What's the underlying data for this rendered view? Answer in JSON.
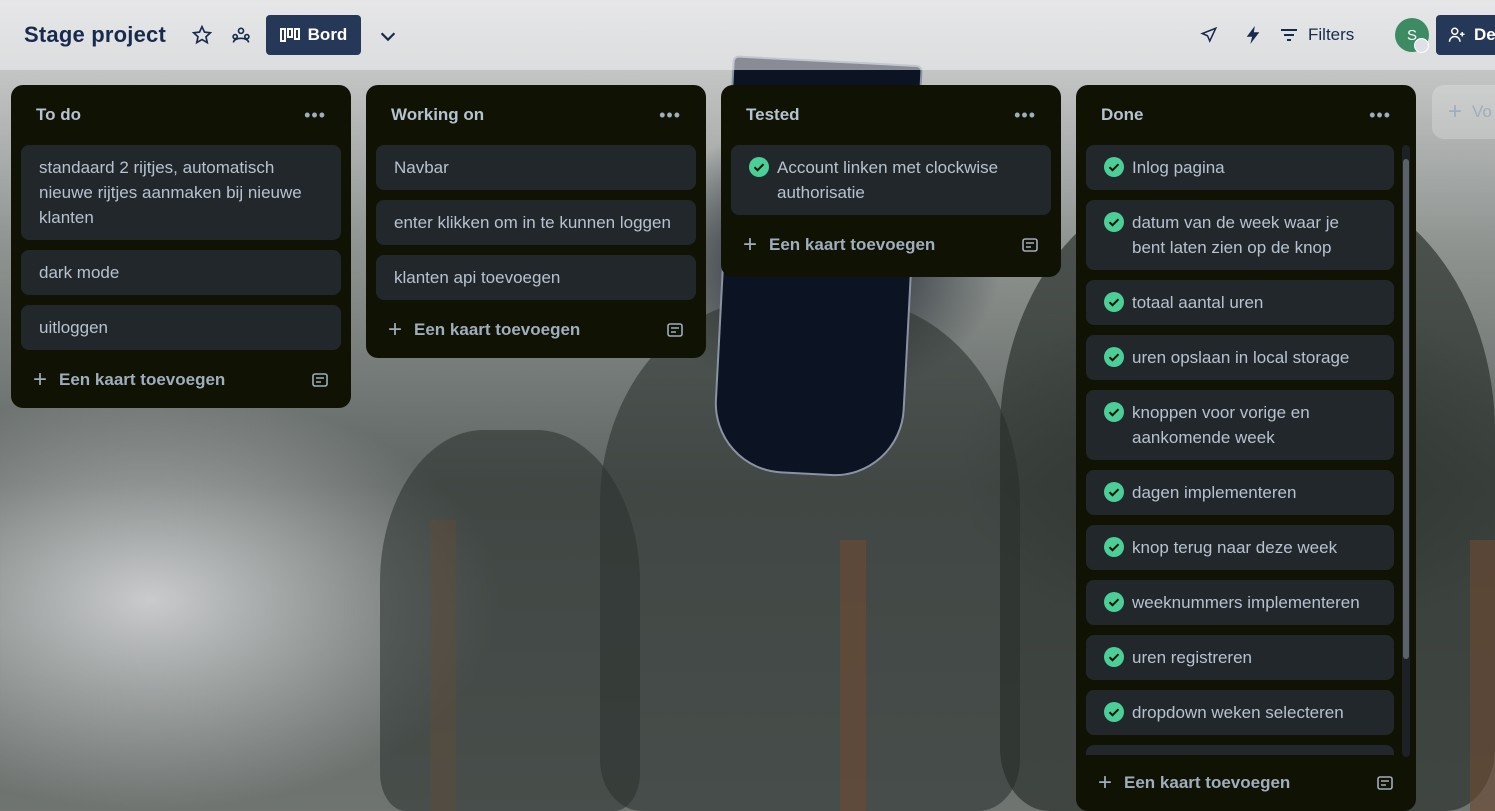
{
  "header": {
    "board_title": "Stage project",
    "view_label": "Bord",
    "filters_label": "Filters",
    "avatar_initial": "S",
    "share_label": "Del"
  },
  "lists": [
    {
      "title": "To do",
      "cards": [
        {
          "text": "standaard 2 rijtjes, automatisch nieuwe rijtjes aanmaken bij nieuwe klanten"
        },
        {
          "text": "dark mode"
        },
        {
          "text": "uitloggen"
        }
      ],
      "add_card_label": "Een kaart toevoegen"
    },
    {
      "title": "Working on",
      "cards": [
        {
          "text": "Navbar"
        },
        {
          "text": "enter klikken om in te kunnen loggen"
        },
        {
          "text": "klanten api toevoegen"
        }
      ],
      "add_card_label": "Een kaart toevoegen"
    },
    {
      "title": "Tested",
      "cards": [
        {
          "text": "Account linken met clockwise authorisatie",
          "done": true
        }
      ],
      "add_card_label": "Een kaart toevoegen"
    },
    {
      "title": "Done",
      "cards": [
        {
          "text": "Inlog pagina",
          "done": true
        },
        {
          "text": "datum van de week waar je bent laten zien op de knop",
          "done": true
        },
        {
          "text": "totaal aantal uren",
          "done": true
        },
        {
          "text": "uren opslaan in local storage",
          "done": true
        },
        {
          "text": "knoppen voor vorige en aankomende week",
          "done": true
        },
        {
          "text": "dagen implementeren",
          "done": true
        },
        {
          "text": "knop terug naar deze week",
          "done": true
        },
        {
          "text": "weeknummers implementeren",
          "done": true
        },
        {
          "text": "uren registreren",
          "done": true
        },
        {
          "text": "dropdown weken selecteren",
          "done": true
        }
      ],
      "add_card_label": "Een kaart toevoegen"
    }
  ],
  "add_list_label": "Vo",
  "colors": {
    "header_button": "#253858",
    "list_bg": "#101204",
    "card_bg": "#22272b",
    "check_green": "#4bce97",
    "avatar_green": "#3d8b63"
  }
}
